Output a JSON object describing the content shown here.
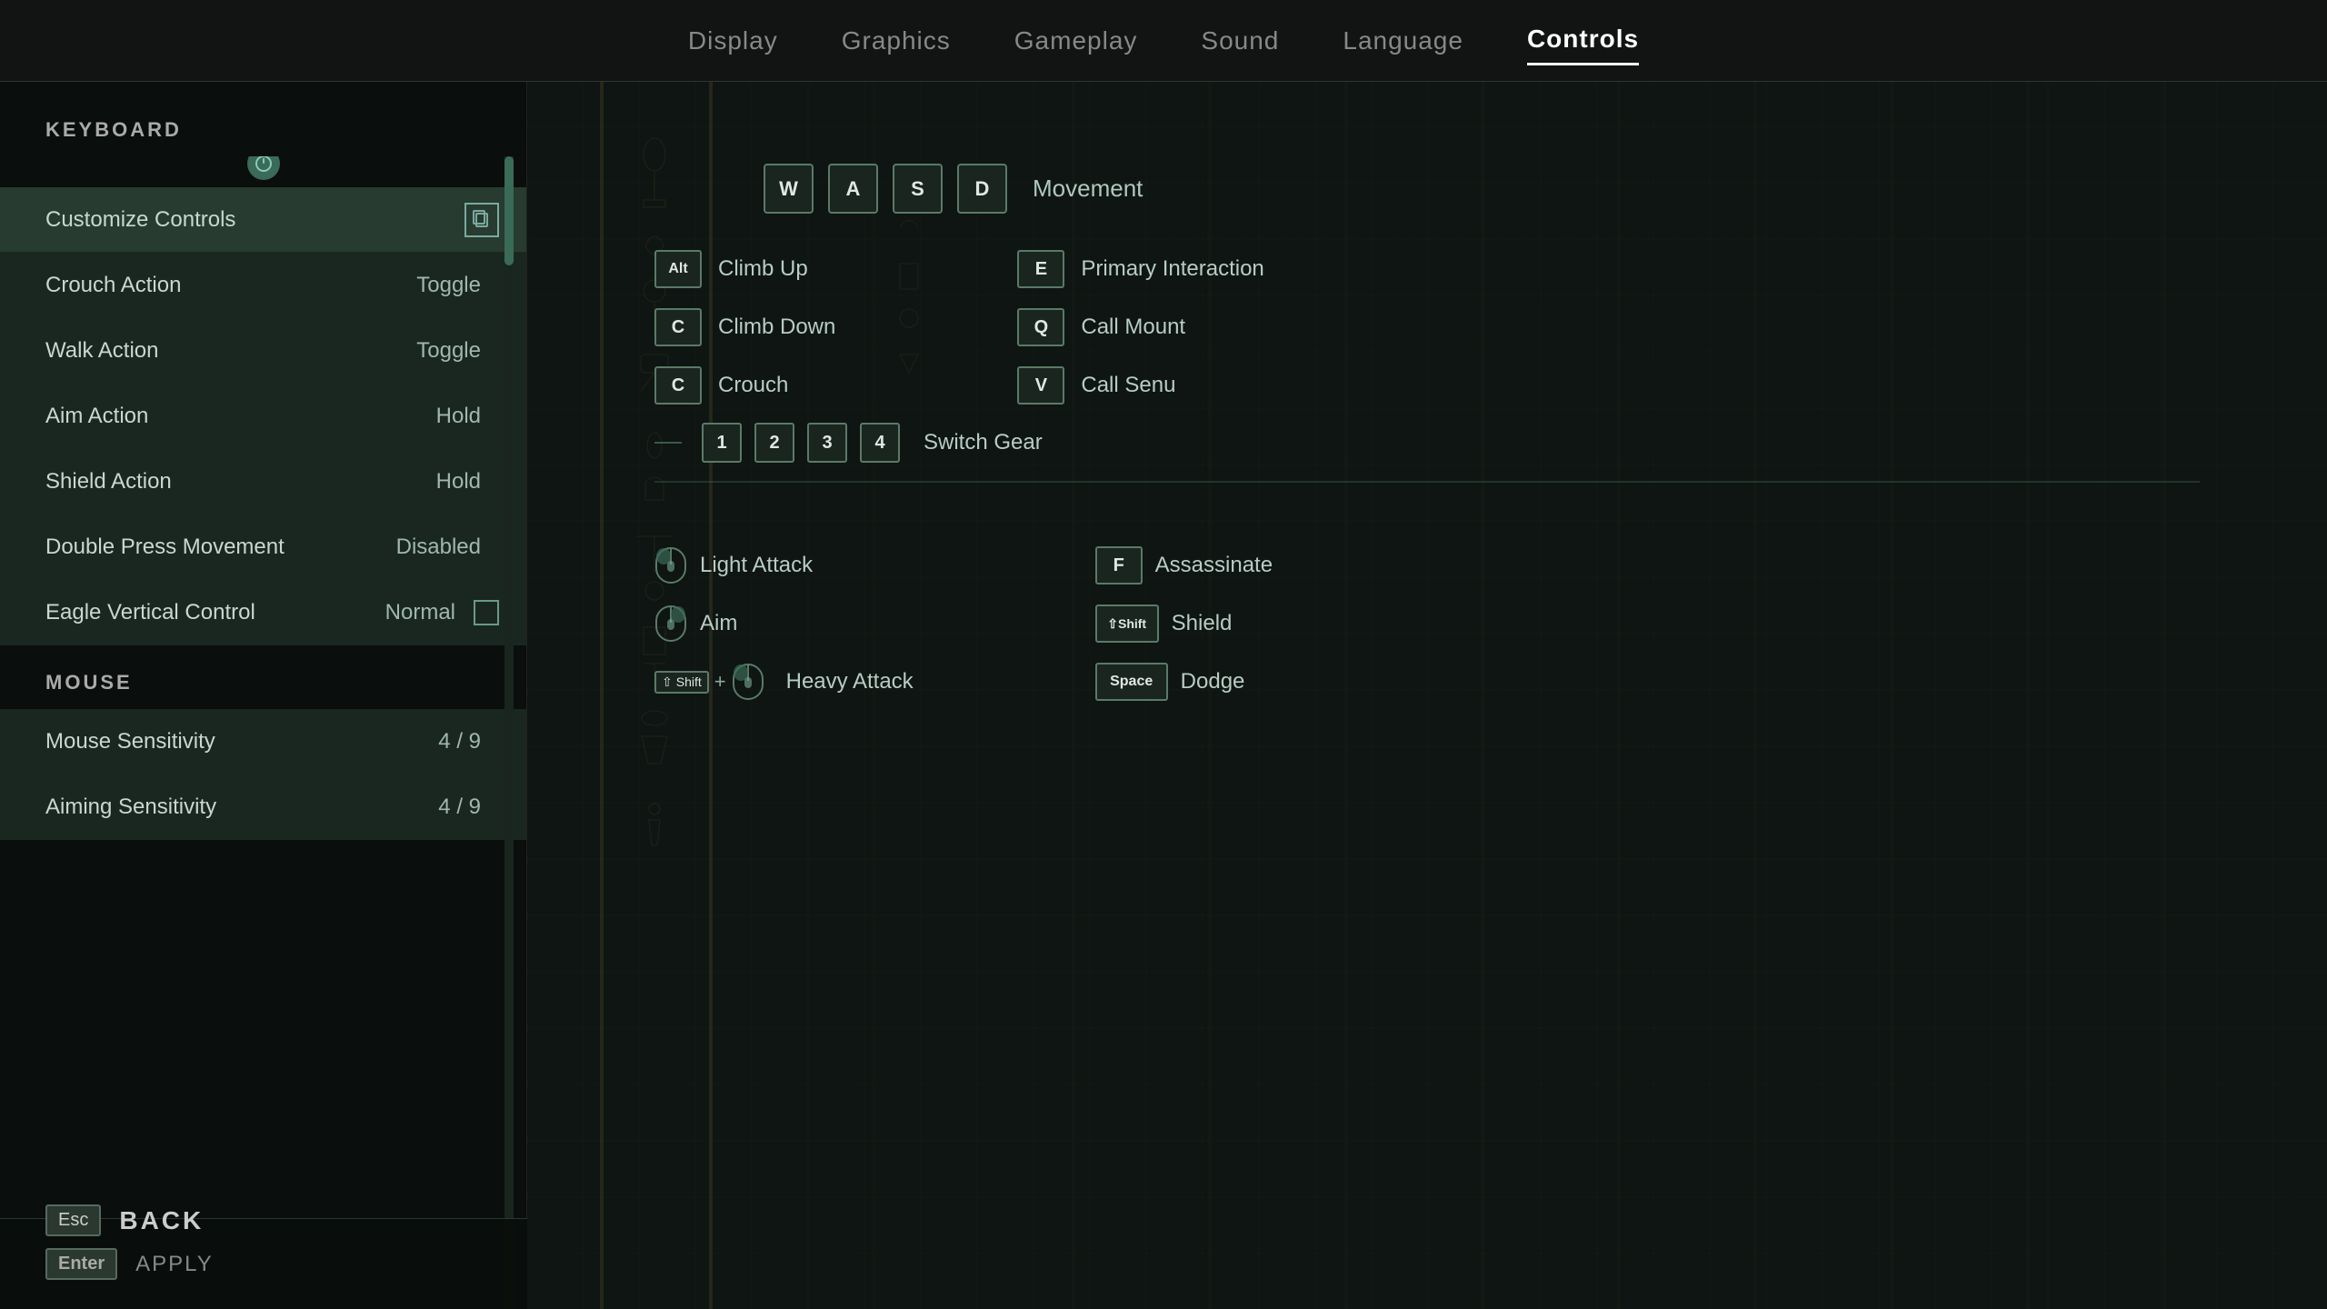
{
  "nav": {
    "items": [
      {
        "id": "display",
        "label": "Display",
        "active": false
      },
      {
        "id": "graphics",
        "label": "Graphics",
        "active": false
      },
      {
        "id": "gameplay",
        "label": "Gameplay",
        "active": false
      },
      {
        "id": "sound",
        "label": "Sound",
        "active": false
      },
      {
        "id": "language",
        "label": "Language",
        "active": false
      },
      {
        "id": "controls",
        "label": "Controls",
        "active": true
      }
    ]
  },
  "left_panel": {
    "keyboard_label": "KEYBOARD",
    "mouse_label": "MOUSE",
    "customize_controls": "Customize Controls",
    "settings": [
      {
        "label": "Crouch Action",
        "value": "Toggle"
      },
      {
        "label": "Walk Action",
        "value": "Toggle"
      },
      {
        "label": "Aim Action",
        "value": "Hold"
      },
      {
        "label": "Shield Action",
        "value": "Hold"
      },
      {
        "label": "Double Press Movement",
        "value": "Disabled"
      },
      {
        "label": "Eagle Vertical Control",
        "value": "Normal",
        "hasCheckbox": true
      }
    ],
    "mouse_settings": [
      {
        "label": "Mouse Sensitivity",
        "value": "4 / 9"
      },
      {
        "label": "Aiming Sensitivity",
        "value": "4 / 9"
      }
    ]
  },
  "bottom": {
    "apply_key": "Enter",
    "apply_label": "APPLY",
    "back_key": "Esc",
    "back_label": "BACK"
  },
  "controls_display": {
    "movement_keys": [
      "W",
      "A",
      "S",
      "D"
    ],
    "movement_label": "Movement",
    "navigation": [
      {
        "key": "Alt",
        "label": "Climb Up",
        "small": false
      },
      {
        "key": "C",
        "label": "Climb Down",
        "small": false
      },
      {
        "key": "C",
        "label": "Crouch",
        "small": false
      }
    ],
    "interactions": [
      {
        "key": "E",
        "label": "Primary Interaction",
        "small": false
      },
      {
        "key": "Q",
        "label": "Call Mount",
        "small": false
      },
      {
        "key": "V",
        "label": "Call Senu",
        "small": false
      }
    ],
    "gear_keys": [
      "1",
      "2",
      "3",
      "4"
    ],
    "gear_label": "Switch Gear",
    "attacks_left": [
      {
        "type": "mouse_left",
        "label": "Light Attack"
      },
      {
        "type": "mouse_right",
        "label": "Aim"
      },
      {
        "type": "combo_shift_mouse",
        "label": "Heavy Attack"
      }
    ],
    "attacks_right": [
      {
        "key": "F",
        "label": "Assassinate",
        "small": false
      },
      {
        "key": "⇧Shift",
        "label": "Shield",
        "small": true
      },
      {
        "key": "Space",
        "label": "Dodge",
        "small": true
      }
    ]
  }
}
